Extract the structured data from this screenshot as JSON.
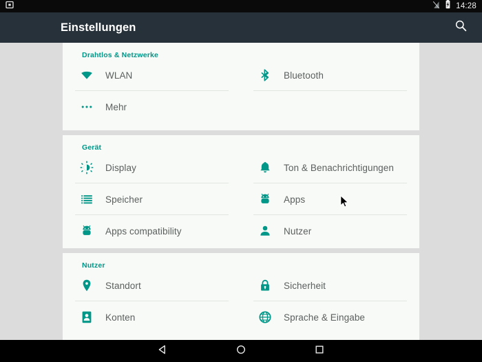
{
  "status_bar": {
    "left_icons": [
      {
        "name": "screenshot-capture-icon"
      }
    ],
    "right_icons": [
      {
        "name": "no-sim-icon"
      },
      {
        "name": "battery-charging-icon"
      }
    ],
    "clock": "14:28"
  },
  "action_bar": {
    "title": "Einstellungen",
    "search_icon": "search-icon"
  },
  "sections": [
    {
      "id": "wireless-networks",
      "title": "Drahtlos & Netzwerke",
      "items": [
        {
          "label": "WLAN",
          "icon": "wifi-icon"
        },
        {
          "label": "Bluetooth",
          "icon": "bluetooth-icon"
        },
        {
          "label": "Mehr",
          "icon": "more-dots-icon"
        }
      ]
    },
    {
      "id": "device",
      "title": "Gerät",
      "items": [
        {
          "label": "Display",
          "icon": "brightness-icon"
        },
        {
          "label": "Ton & Benachrichtigungen",
          "icon": "bell-icon"
        },
        {
          "label": "Speicher",
          "icon": "storage-list-icon"
        },
        {
          "label": "Apps",
          "icon": "android-robot-icon"
        },
        {
          "label": "Apps compatibility",
          "icon": "android-robot-icon"
        },
        {
          "label": "Nutzer",
          "icon": "person-icon"
        }
      ]
    },
    {
      "id": "personal",
      "title": "Nutzer",
      "items": [
        {
          "label": "Standort",
          "icon": "location-pin-icon"
        },
        {
          "label": "Sicherheit",
          "icon": "lock-icon"
        },
        {
          "label": "Konten",
          "icon": "contact-card-icon"
        },
        {
          "label": "Sprache & Eingabe",
          "icon": "globe-icon"
        }
      ]
    }
  ],
  "nav_bar": {
    "back": "back-triangle-icon",
    "home": "home-circle-icon",
    "recents": "recents-square-icon"
  },
  "colors": {
    "accent": "#009688",
    "action_bar": "#263139",
    "page_background": "#dcdcdc",
    "card_background": "#f7faf6",
    "label_text": "#5b5f5e"
  }
}
